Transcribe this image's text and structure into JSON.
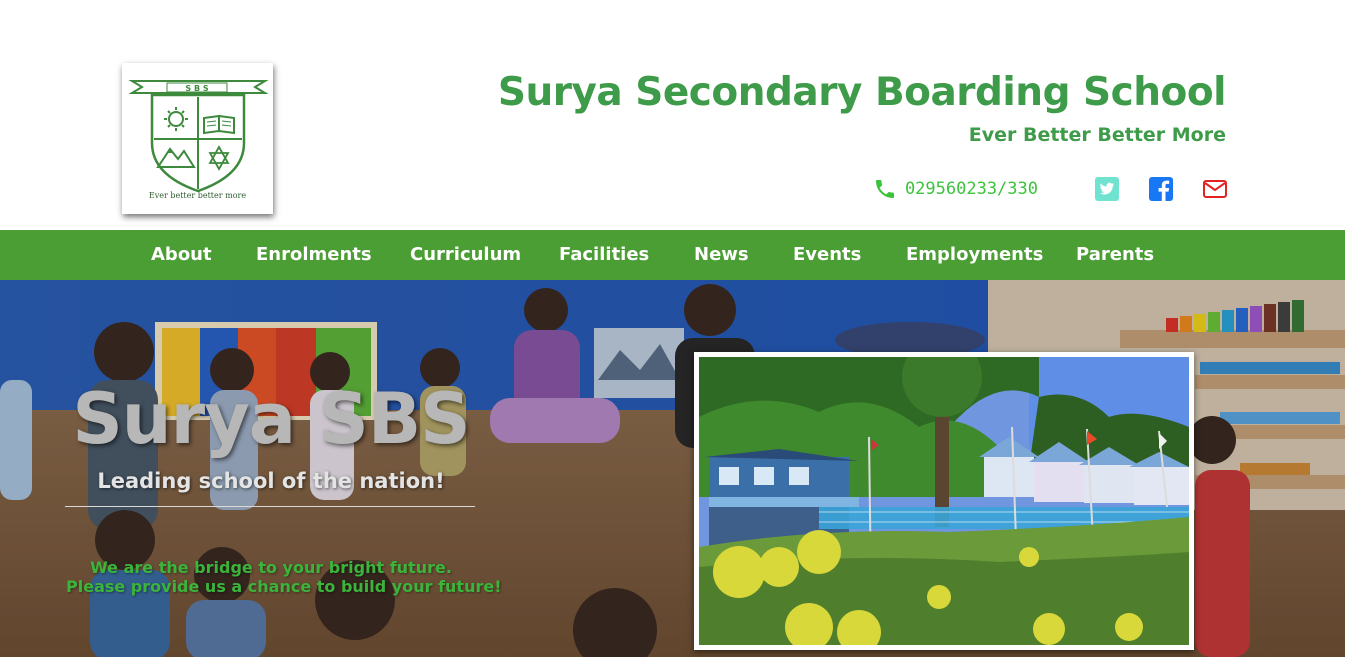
{
  "header": {
    "logo": {
      "crest_letters": "S B S",
      "motto": "Ever better better more"
    },
    "school_name": "Surya Secondary Boarding School",
    "tagline": "Ever Better Better More",
    "contact": {
      "phone_icon": "phone-icon",
      "phone": "029560233/330",
      "social": [
        {
          "name": "twitter-icon",
          "color": "#6fe3d0"
        },
        {
          "name": "facebook-icon",
          "color": "#1877f2"
        },
        {
          "name": "mail-icon",
          "color": "#e02424"
        }
      ]
    }
  },
  "nav": {
    "items": [
      {
        "label": "About"
      },
      {
        "label": "Enrolments"
      },
      {
        "label": "Curriculum"
      },
      {
        "label": "Facilities"
      },
      {
        "label": "News"
      },
      {
        "label": "Events"
      },
      {
        "label": "Employments"
      },
      {
        "label": "Parents"
      }
    ],
    "color": "#4a9e33"
  },
  "hero": {
    "title": "Surya SBS",
    "subtitle": "Leading school of the nation!",
    "lines": [
      "We are the bridge to your bright future.",
      "Please provide us a chance to build your future!"
    ],
    "photo": "school building photo"
  },
  "colors": {
    "brand_green": "#3e9b4a",
    "nav_green": "#4a9e33",
    "phone_green": "#3bc43b"
  }
}
